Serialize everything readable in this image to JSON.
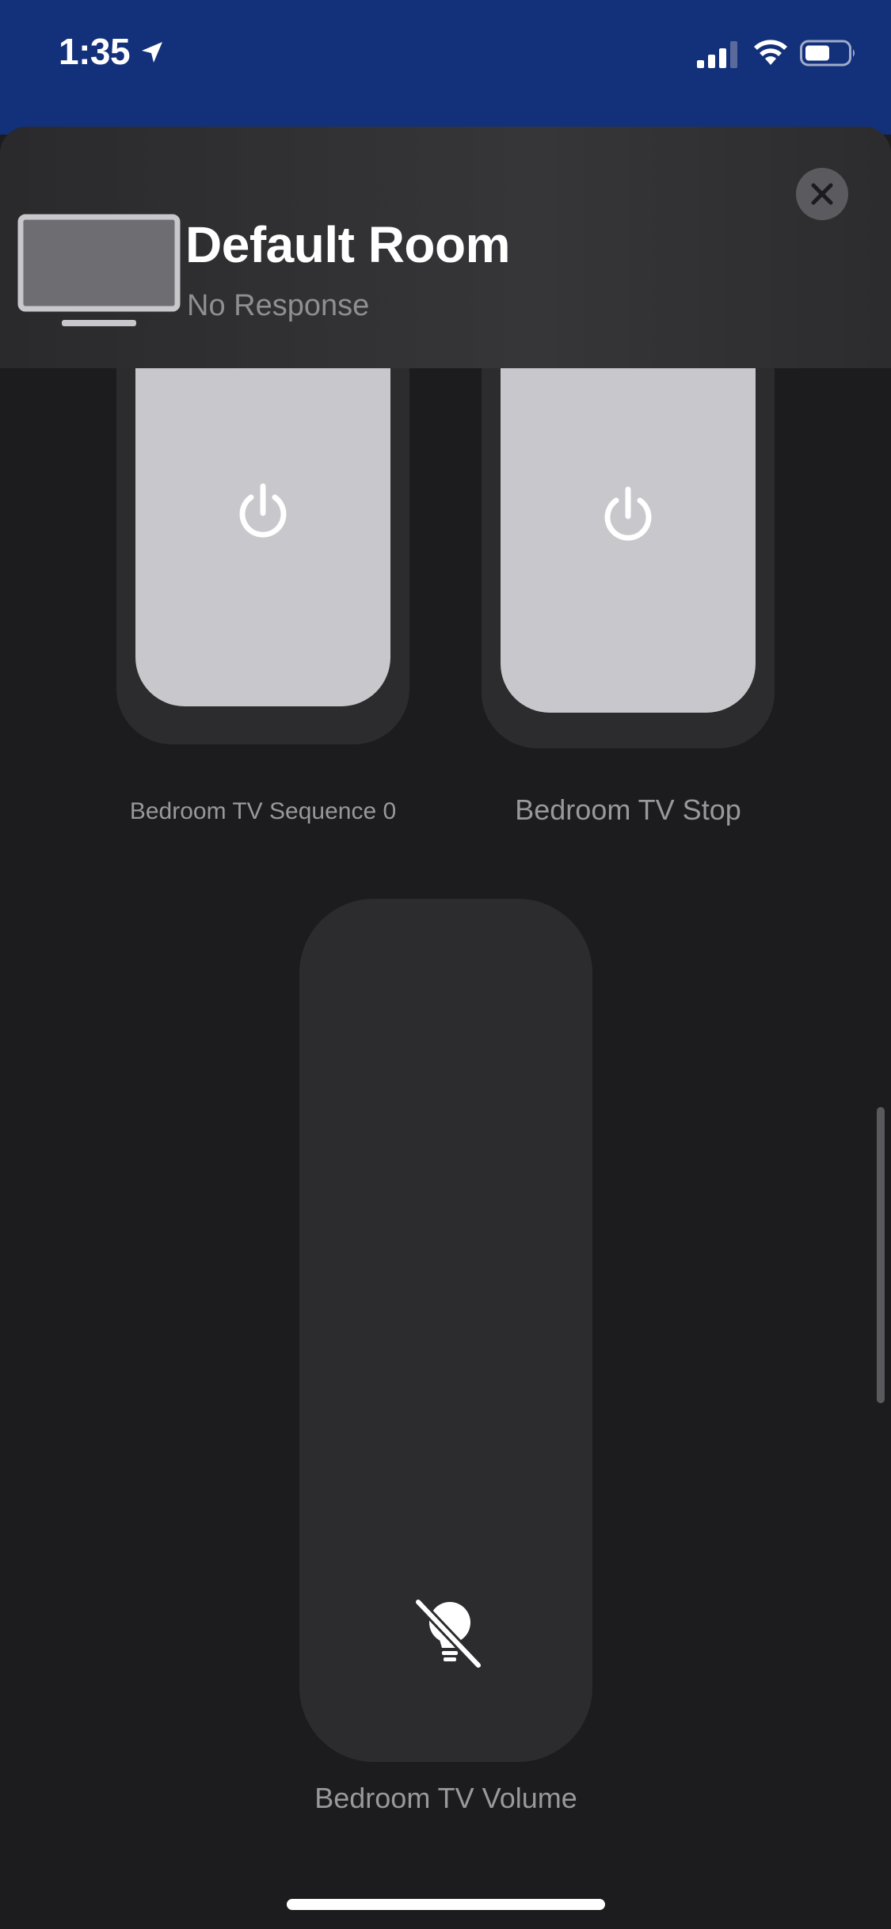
{
  "status_bar": {
    "time": "1:35",
    "icons": [
      "location-arrow-icon",
      "cellular-signal-icon",
      "wifi-icon",
      "battery-icon"
    ]
  },
  "sheet": {
    "title": "Default Room",
    "subtitle": "No Response",
    "icon": "tv-icon",
    "close_icon": "close-icon"
  },
  "tiles": [
    {
      "label": "Bedroom TV Sequence 0",
      "icon": "power-icon"
    },
    {
      "label": "Bedroom TV Stop",
      "icon": "power-icon"
    },
    {
      "label": "Bedroom TV Volume",
      "icon": "lightbulb-slash-icon"
    }
  ],
  "colors": {
    "status_bar_bg": "#13307a",
    "sheet_bg": "#1c1c1e",
    "tile_active": "#c7c7cc",
    "tile_inactive": "#2c2c2e",
    "label_gray": "#8e8e93"
  }
}
